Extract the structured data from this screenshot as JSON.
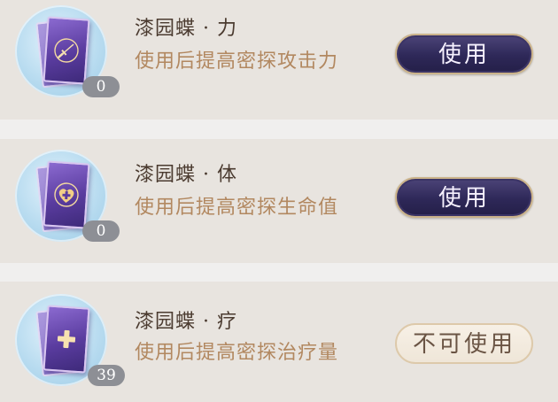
{
  "items": [
    {
      "name": "漆园蝶 · 力",
      "description": "使用后提高密探攻击力",
      "count": "0",
      "icon": "sword-icon",
      "button_label": "使用",
      "button_enabled": true
    },
    {
      "name": "漆园蝶 · 体",
      "description": "使用后提高密探生命值",
      "count": "0",
      "icon": "heart-cross-icon",
      "button_label": "使用",
      "button_enabled": true
    },
    {
      "name": "漆园蝶 · 疗",
      "description": "使用后提高密探治疗量",
      "count": "39",
      "icon": "cross-icon",
      "button_label": "不可使用",
      "button_enabled": false
    }
  ],
  "colors": {
    "row_background": "#e8e4df",
    "separator": "#f0efee",
    "title": "#4b3b30",
    "description": "#b28860",
    "button_active": "#2e2858",
    "button_disabled": "#efe6d8"
  }
}
